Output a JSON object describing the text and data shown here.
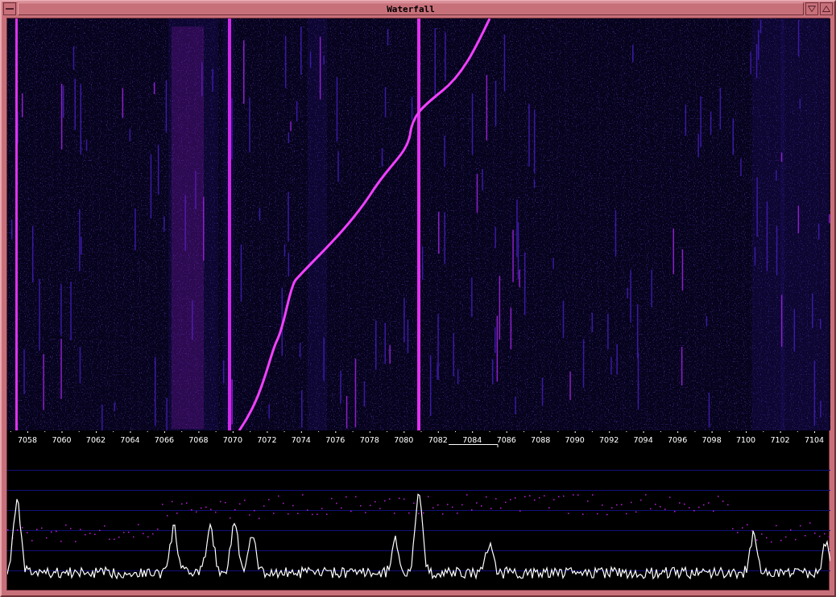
{
  "window": {
    "title": "Waterfall"
  },
  "frequency_axis": {
    "labels": [
      "7058",
      "7060",
      "7062",
      "7064",
      "7066",
      "7068",
      "7070",
      "7072",
      "7074",
      "7076",
      "7078",
      "7080",
      "7082",
      "7084",
      "7086",
      "7088",
      "7090",
      "7092",
      "7094",
      "7096",
      "7098",
      "7100",
      "7102",
      "7104"
    ]
  }
}
